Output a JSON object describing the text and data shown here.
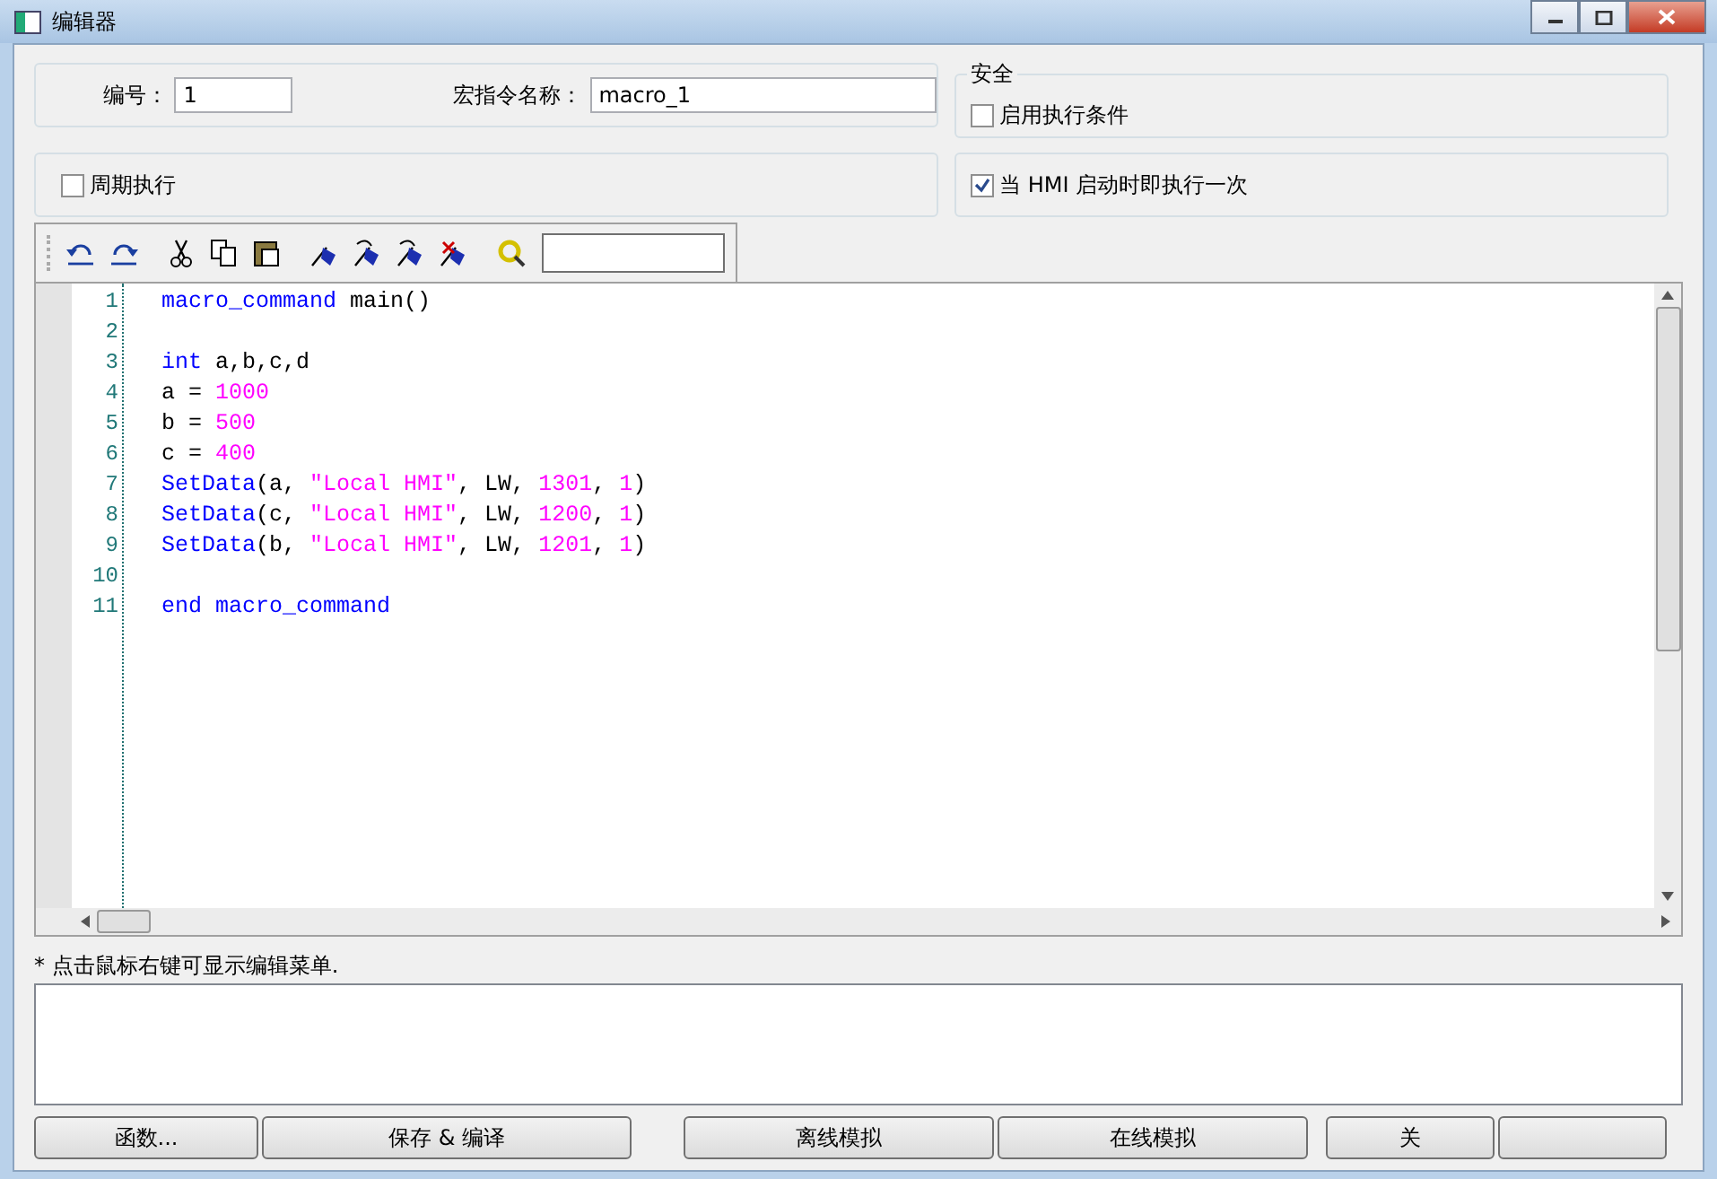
{
  "window": {
    "title": "编辑器"
  },
  "number_field": {
    "label": "编号：",
    "value": "1"
  },
  "name_field": {
    "label": "宏指令名称：",
    "value": "macro_1"
  },
  "security": {
    "legend": "安全",
    "checkbox": {
      "label": "启用执行条件",
      "checked": false
    }
  },
  "periodic": {
    "label": "周期执行",
    "checked": false
  },
  "run_on_start": {
    "label": "当 HMI 启动时即执行一次",
    "checked": true
  },
  "editor": {
    "lines": [
      {
        "number": "1",
        "tokens": [
          {
            "kind": "keyword",
            "text": "macro_command"
          },
          {
            "kind": "plain",
            "text": " main()"
          }
        ]
      },
      {
        "number": "2"
      },
      {
        "number": "3",
        "tokens": [
          {
            "kind": "keyword",
            "text": "int"
          },
          {
            "kind": "plain",
            "text": " a,b,c,d"
          }
        ]
      },
      {
        "number": "4",
        "tokens": [
          {
            "kind": "plain",
            "text": "a = "
          },
          {
            "kind": "number",
            "text": "1000"
          }
        ]
      },
      {
        "number": "5",
        "tokens": [
          {
            "kind": "plain",
            "text": "b = "
          },
          {
            "kind": "number",
            "text": "500"
          }
        ]
      },
      {
        "number": "6",
        "tokens": [
          {
            "kind": "plain",
            "text": "c = "
          },
          {
            "kind": "number",
            "text": "400"
          }
        ]
      },
      {
        "number": "7",
        "tokens": [
          {
            "kind": "keyword",
            "text": "SetData"
          },
          {
            "kind": "plain",
            "text": "(a, "
          },
          {
            "kind": "string",
            "text": "\"Local HMI\""
          },
          {
            "kind": "plain",
            "text": ", LW, "
          },
          {
            "kind": "number",
            "text": "1301"
          },
          {
            "kind": "plain",
            "text": ", "
          },
          {
            "kind": "number",
            "text": "1"
          },
          {
            "kind": "plain",
            "text": ")"
          }
        ]
      },
      {
        "number": "8",
        "tokens": [
          {
            "kind": "keyword",
            "text": "SetData"
          },
          {
            "kind": "plain",
            "text": "(c, "
          },
          {
            "kind": "string",
            "text": "\"Local HMI\""
          },
          {
            "kind": "plain",
            "text": ", LW, "
          },
          {
            "kind": "number",
            "text": "1200"
          },
          {
            "kind": "plain",
            "text": ", "
          },
          {
            "kind": "number",
            "text": "1"
          },
          {
            "kind": "plain",
            "text": ")"
          }
        ]
      },
      {
        "number": "9",
        "tokens": [
          {
            "kind": "keyword",
            "text": "SetData"
          },
          {
            "kind": "plain",
            "text": "(b, "
          },
          {
            "kind": "string",
            "text": "\"Local HMI\""
          },
          {
            "kind": "plain",
            "text": ", LW, "
          },
          {
            "kind": "number",
            "text": "1201"
          },
          {
            "kind": "plain",
            "text": ", "
          },
          {
            "kind": "number",
            "text": "1"
          },
          {
            "kind": "plain",
            "text": ")"
          }
        ]
      },
      {
        "number": "10"
      },
      {
        "number": "11",
        "tokens": [
          {
            "kind": "keyword",
            "text": "end macro_command"
          }
        ]
      }
    ]
  },
  "hint": "* 点击鼠标右键可显示编辑菜单.",
  "buttons": [
    {
      "label": "函数..."
    },
    {
      "label": "保存 & 编译"
    },
    {
      "label": "离线模拟"
    },
    {
      "label": "在线模拟"
    },
    {
      "label": "关"
    }
  ]
}
